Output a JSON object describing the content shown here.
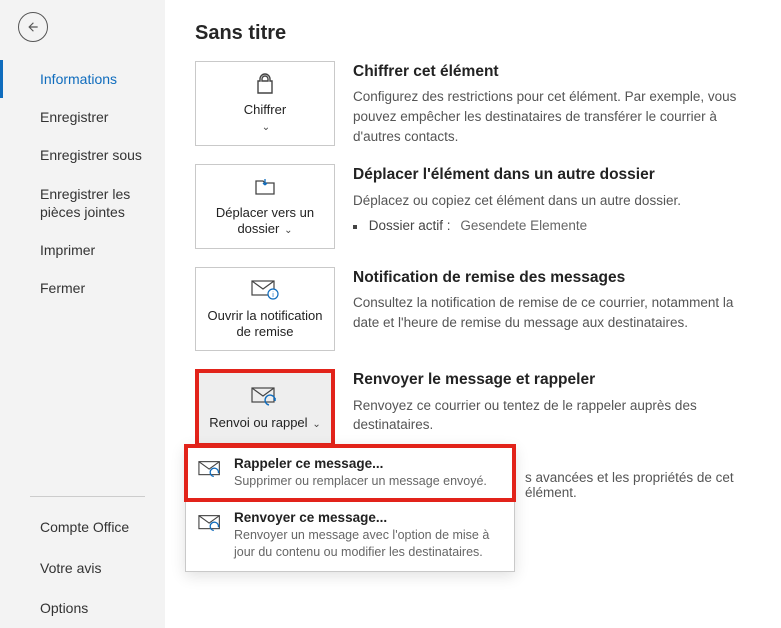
{
  "page_title": "Sans titre",
  "sidebar": {
    "items": [
      "Informations",
      "Enregistrer",
      "Enregistrer sous",
      "Enregistrer les pièces jointes",
      "Imprimer",
      "Fermer"
    ],
    "bottom": [
      "Compte Office",
      "Votre avis",
      "Options"
    ]
  },
  "tiles": {
    "encrypt": {
      "label": "Chiffrer",
      "heading": "Chiffrer cet élément",
      "desc": "Configurez des restrictions pour cet élément. Par exemple, vous pouvez empêcher les destinataires de transférer le courrier à d'autres contacts."
    },
    "move": {
      "label": "Déplacer vers un dossier",
      "heading": "Déplacer l'élément dans un autre dossier",
      "desc": "Déplacez ou copiez cet élément dans un autre dossier.",
      "meta_label": "Dossier actif :",
      "meta_value": "Gesendete Elemente"
    },
    "receipt": {
      "label": "Ouvrir la notification de remise",
      "heading": "Notification de remise des messages",
      "desc": "Consultez la notification de remise de ce courrier, notamment la date et l'heure de remise du message aux destinataires."
    },
    "recall": {
      "label": "Renvoi ou rappel",
      "heading": "Renvoyer le message et rappeler",
      "desc": "Renvoyez ce courrier ou tentez de le rappeler auprès des destinataires."
    }
  },
  "popup": {
    "recall": {
      "title": "Rappeler ce message...",
      "desc": "Supprimer ou remplacer un message envoyé."
    },
    "resend": {
      "title": "Renvoyer ce message...",
      "desc": "Renvoyer un message avec l'option de mise à jour du contenu ou modifier les destinataires."
    }
  },
  "trailing": "s avancées et les propriétés de cet élément."
}
